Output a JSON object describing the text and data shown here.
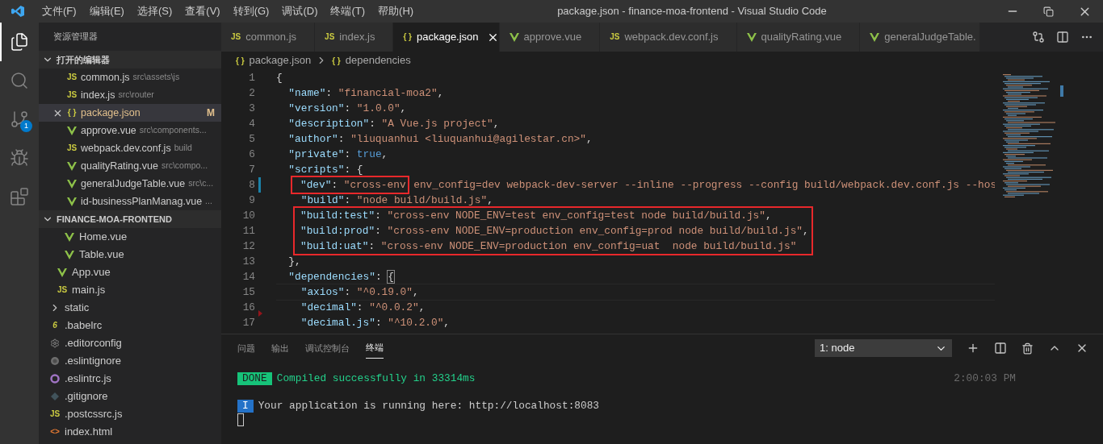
{
  "menu": [
    "文件(F)",
    "编辑(E)",
    "选择(S)",
    "查看(V)",
    "转到(G)",
    "调试(D)",
    "终端(T)",
    "帮助(H)"
  ],
  "window": {
    "title": "package.json - finance-moa-frontend - Visual Studio Code"
  },
  "activity_bar": [
    {
      "kind": "files",
      "selected": true
    },
    {
      "kind": "search",
      "selected": false
    },
    {
      "kind": "scm",
      "selected": false,
      "badge": "1"
    },
    {
      "kind": "debug",
      "selected": false
    },
    {
      "kind": "extensions",
      "selected": false
    }
  ],
  "sidebar": {
    "title": "资源管理器",
    "open_editors": {
      "title": "打开的编辑器",
      "expanded": true,
      "items": [
        {
          "kind": "js",
          "glyph": "JS",
          "name": "common.js",
          "path": "src\\assets\\js",
          "selected": false
        },
        {
          "kind": "js",
          "glyph": "JS",
          "name": "index.js",
          "path": "src\\router",
          "selected": false
        },
        {
          "kind": "json",
          "glyph": "{ }",
          "name": "package.json",
          "badge": "M",
          "selected": true
        },
        {
          "kind": "vue",
          "name": "approve.vue",
          "path": "src\\components...",
          "selected": false
        },
        {
          "kind": "js",
          "glyph": "JS",
          "name": "webpack.dev.conf.js",
          "path": "build",
          "selected": false
        },
        {
          "kind": "vue",
          "name": "qualityRating.vue",
          "path": "src\\compo...",
          "selected": false
        },
        {
          "kind": "vue",
          "name": "generalJudgeTable.vue",
          "path": "src\\c...",
          "selected": false
        },
        {
          "kind": "vue",
          "name": "id-businessPlanManag.vue",
          "path": "...",
          "selected": false
        }
      ]
    },
    "project": {
      "title": "FINANCE-MOA-FRONTEND",
      "expanded": true,
      "tree": [
        {
          "children": [
            {
              "children": [
                {
                  "kind": "vue",
                  "name": "Home.vue"
                },
                {
                  "kind": "vue",
                  "name": "Table.vue"
                }
              ]
            },
            {
              "kind": "vue",
              "name": "App.vue"
            },
            {
              "kind": "js",
              "glyph": "JS",
              "name": "main.js"
            }
          ]
        },
        {
          "kind": "folder",
          "name": "static",
          "expanded": false
        },
        {
          "kind": "babel",
          "glyph": "6",
          "name": ".babelrc"
        },
        {
          "kind": "gear",
          "name": ".editorconfig"
        },
        {
          "kind": "eslintignore",
          "name": ".eslintignore"
        },
        {
          "kind": "eslintrc",
          "name": ".eslintrc.js"
        },
        {
          "kind": "git",
          "name": ".gitignore"
        },
        {
          "kind": "js",
          "glyph": "JS",
          "name": ".postcssrc.js"
        },
        {
          "kind": "html",
          "glyph": "<>",
          "name": "index.html"
        }
      ]
    }
  },
  "tabs": [
    {
      "kind": "js",
      "glyph": "JS",
      "name": "common.js",
      "selected": false
    },
    {
      "kind": "js",
      "glyph": "JS",
      "name": "index.js",
      "selected": false
    },
    {
      "kind": "json",
      "glyph": "{ }",
      "name": "package.json",
      "selected": true
    },
    {
      "kind": "vue",
      "name": "approve.vue",
      "selected": false
    },
    {
      "kind": "js",
      "glyph": "JS",
      "name": "webpack.dev.conf.js",
      "selected": false
    },
    {
      "kind": "vue",
      "name": "qualityRating.vue",
      "selected": false
    },
    {
      "kind": "vue",
      "name": "generalJudgeTable.",
      "selected": false
    }
  ],
  "breadcrumb": [
    {
      "glyph": "{ }",
      "name": "package.json"
    },
    {
      "glyph": "{ }",
      "name": "dependencies"
    }
  ],
  "code": [
    {
      "no": "1",
      "tokens": [
        {
          "kind": "punct",
          "text": "{"
        }
      ]
    },
    {
      "no": "2",
      "tokens": [
        {
          "kind": "key",
          "text": "  \"name\""
        },
        {
          "kind": "punct",
          "text": ": "
        },
        {
          "kind": "string",
          "text": "\"financial-moa2\""
        },
        {
          "kind": "punct",
          "text": ","
        }
      ]
    },
    {
      "no": "3",
      "tokens": [
        {
          "kind": "key",
          "text": "  \"version\""
        },
        {
          "kind": "punct",
          "text": ": "
        },
        {
          "kind": "string",
          "text": "\"1.0.0\""
        },
        {
          "kind": "punct",
          "text": ","
        }
      ]
    },
    {
      "no": "4",
      "tokens": [
        {
          "kind": "key",
          "text": "  \"description\""
        },
        {
          "kind": "punct",
          "text": ": "
        },
        {
          "kind": "string",
          "text": "\"A Vue.js project\""
        },
        {
          "kind": "punct",
          "text": ","
        }
      ]
    },
    {
      "no": "5",
      "tokens": [
        {
          "kind": "key",
          "text": "  \"author\""
        },
        {
          "kind": "punct",
          "text": ": "
        },
        {
          "kind": "string",
          "text": "\"liuquanhui <liuquanhui@agilestar.cn>\""
        },
        {
          "kind": "punct",
          "text": ","
        }
      ]
    },
    {
      "no": "6",
      "tokens": [
        {
          "kind": "key",
          "text": "  \"private\""
        },
        {
          "kind": "punct",
          "text": ": "
        },
        {
          "kind": "bool",
          "text": "true"
        },
        {
          "kind": "punct",
          "text": ","
        }
      ]
    },
    {
      "no": "7",
      "tokens": [
        {
          "kind": "key",
          "text": "  \"scripts\""
        },
        {
          "kind": "punct",
          "text": ": {"
        }
      ]
    },
    {
      "no": "8",
      "modified_marker": true,
      "segments": [
        {
          "boxed": true,
          "tokens": [
            {
              "kind": "key",
              "text": "\"dev\""
            },
            {
              "kind": "punct",
              "text": ": "
            },
            {
              "kind": "string",
              "text": "\"cross-env"
            }
          ]
        },
        {
          "boxed": false,
          "tokens": [
            {
              "kind": "string",
              "text": " env_config=dev webpack-dev-server --inline --progress --config build/webpack.dev.conf.js --hos"
            }
          ]
        }
      ]
    },
    {
      "no": "9",
      "tokens": [
        {
          "kind": "key",
          "text": "    \"build\""
        },
        {
          "kind": "punct",
          "text": ": "
        },
        {
          "kind": "string",
          "text": "\"node build/build.js\""
        },
        {
          "kind": "punct",
          "text": ","
        }
      ]
    },
    {
      "kind": "group",
      "boxed": true,
      "lines": [
        {
          "no": "10",
          "tokens": [
            {
              "kind": "key",
              "text": "\"build:test\""
            },
            {
              "kind": "punct",
              "text": ": "
            },
            {
              "kind": "string",
              "text": "\"cross-env NODE_ENV=test env_config=test node build/build.js\""
            },
            {
              "kind": "punct",
              "text": ","
            }
          ]
        },
        {
          "no": "11",
          "tokens": [
            {
              "kind": "key",
              "text": "\"build:prod\""
            },
            {
              "kind": "punct",
              "text": ": "
            },
            {
              "kind": "string",
              "text": "\"cross-env NODE_ENV=production env_config=prod node build/build.js\""
            },
            {
              "kind": "punct",
              "text": ","
            }
          ]
        },
        {
          "no": "12",
          "tokens": [
            {
              "kind": "key",
              "text": "\"build:uat\""
            },
            {
              "kind": "punct",
              "text": ": "
            },
            {
              "kind": "string",
              "text": "\"cross-env NODE_ENV=production env_config=uat  node build/build.js\""
            }
          ]
        }
      ]
    },
    {
      "no": "13",
      "tokens": [
        {
          "kind": "punct",
          "text": "  },"
        }
      ]
    },
    {
      "no": "14",
      "tokens": [
        {
          "kind": "key",
          "text": "  \"dependencies\""
        },
        {
          "kind": "punct",
          "text": ": "
        },
        {
          "kind": "bracket_match",
          "text": "{"
        }
      ]
    },
    {
      "no": "15",
      "current": true,
      "tokens": [
        {
          "kind": "key",
          "text": "    \"axios\""
        },
        {
          "kind": "punct",
          "text": ": "
        },
        {
          "kind": "string",
          "text": "\"^0.19.0\""
        },
        {
          "kind": "punct",
          "text": ","
        }
      ]
    },
    {
      "no": "16",
      "deleted_marker": true,
      "tokens": [
        {
          "kind": "key",
          "text": "    \"decimal\""
        },
        {
          "kind": "punct",
          "text": ": "
        },
        {
          "kind": "string",
          "text": "\"^0.0.2\""
        },
        {
          "kind": "punct",
          "text": ","
        }
      ]
    },
    {
      "no": "17",
      "tokens": [
        {
          "kind": "key",
          "text": "    \"decimal.js\""
        },
        {
          "kind": "punct",
          "text": ": "
        },
        {
          "kind": "string",
          "text": "\"^10.2.0\""
        },
        {
          "kind": "punct",
          "text": ","
        }
      ]
    }
  ],
  "panel": {
    "tabs": [
      {
        "label": "问题",
        "selected": false
      },
      {
        "label": "输出",
        "selected": false
      },
      {
        "label": "调试控制台",
        "selected": false
      },
      {
        "label": "终端",
        "selected": true
      }
    ],
    "terminal_select": "1: node",
    "lines": [
      {
        "badge": {
          "kind": "done",
          "text": "DONE"
        },
        "text": "Compiled successfully in 33314ms",
        "time": "2:00:03 PM"
      },
      {
        "badge": {
          "kind": "info",
          "text": "I"
        },
        "text": "Your application is running here: http://localhost:8083"
      }
    ]
  }
}
